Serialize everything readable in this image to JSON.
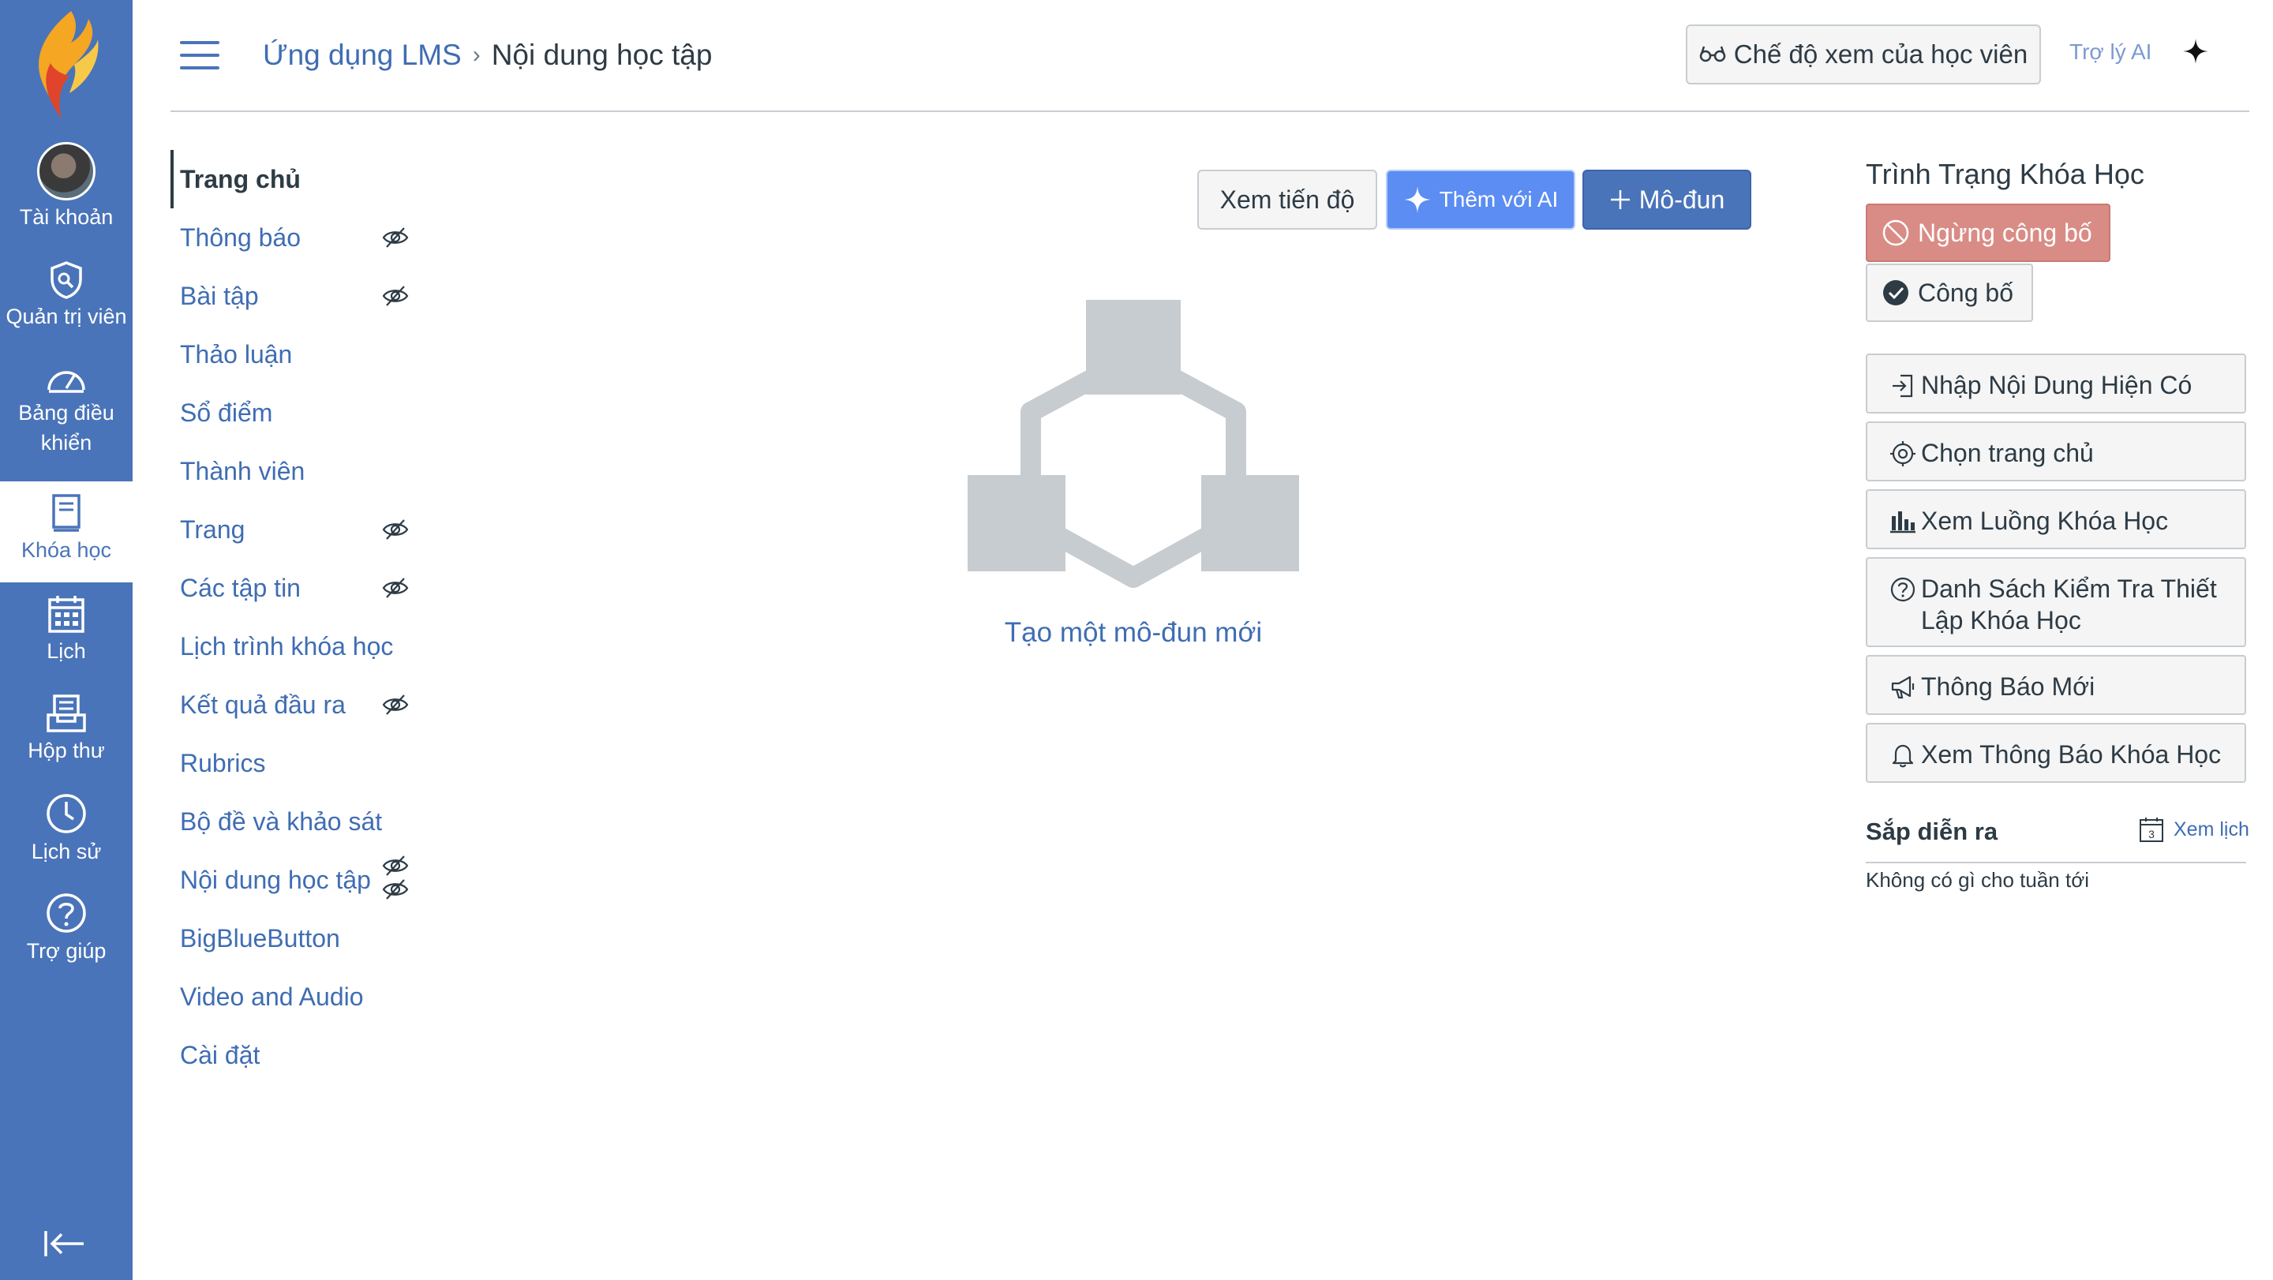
{
  "global_nav": {
    "items": [
      {
        "label": "Tài khoản",
        "icon": "avatar"
      },
      {
        "label": "Quản trị viên",
        "icon": "shield-icon"
      },
      {
        "label": "Bảng điều khiển",
        "icon": "dashboard-icon"
      },
      {
        "label": "Khóa học",
        "icon": "courses-icon",
        "active": true
      },
      {
        "label": "Lịch",
        "icon": "calendar-icon"
      },
      {
        "label": "Hộp thư",
        "icon": "inbox-icon"
      },
      {
        "label": "Lịch sử",
        "icon": "clock-icon"
      },
      {
        "label": "Trợ giúp",
        "icon": "help-icon"
      }
    ],
    "colors": {
      "nav_bg": "#4a74b9",
      "active_bg": "#ffffff"
    }
  },
  "header": {
    "breadcrumb_root": "Ứng dụng LMS",
    "breadcrumb_current": "Nội dung học tập",
    "student_view_label": "Chế độ xem của học viên",
    "ai_assistant_label": "Trợ lý AI"
  },
  "course_nav": {
    "items": [
      {
        "label": "Trang chủ",
        "active": true,
        "hidden": false
      },
      {
        "label": "Thông báo",
        "hidden": true
      },
      {
        "label": "Bài tập",
        "hidden": true
      },
      {
        "label": "Thảo luận",
        "hidden": false
      },
      {
        "label": "Sổ điểm",
        "hidden": false
      },
      {
        "label": "Thành viên",
        "hidden": false
      },
      {
        "label": "Trang",
        "hidden": true
      },
      {
        "label": "Các tập tin",
        "hidden": true
      },
      {
        "label": "Lịch trình khóa học",
        "hidden": false
      },
      {
        "label": "Kết quả đầu ra",
        "hidden": true
      },
      {
        "label": "Rubrics",
        "hidden": false
      },
      {
        "label": "Bộ đề và khảo sát",
        "hidden": false
      },
      {
        "label": "Nội dung học tập",
        "hidden": true
      },
      {
        "label": "BigBlueButton",
        "hidden": false
      },
      {
        "label": "Video and Audio",
        "hidden": false
      },
      {
        "label": "Cài đặt",
        "hidden": false
      }
    ]
  },
  "main": {
    "progress_button": "Xem tiến độ",
    "add_ai_button": "Thêm với AI",
    "add_module_button": "Mô-đun",
    "empty_state_text": "Tạo một mô-đun mới"
  },
  "sidebar": {
    "status_title": "Trình Trạng Khóa Học",
    "unpublish_label": "Ngừng công bố",
    "publish_label": "Công bố",
    "actions": [
      {
        "label": "Nhập Nội Dung Hiện Có",
        "icon": "import-icon"
      },
      {
        "label": "Chọn trang chủ",
        "icon": "target-icon"
      },
      {
        "label": "Xem Luồng Khóa Học",
        "icon": "bar-chart-icon"
      },
      {
        "label": "Danh Sách Kiểm Tra Thiết Lập Khóa Học",
        "icon": "question-circle-icon"
      },
      {
        "label": "Thông Báo Mới",
        "icon": "megaphone-icon"
      },
      {
        "label": "Xem Thông Báo Khóa Học",
        "icon": "bell-icon"
      }
    ],
    "upcoming_title": "Sắp diễn ra",
    "calendar_link": "Xem lịch",
    "calendar_day": "3",
    "upcoming_empty": "Không có gì cho tuần tới"
  }
}
